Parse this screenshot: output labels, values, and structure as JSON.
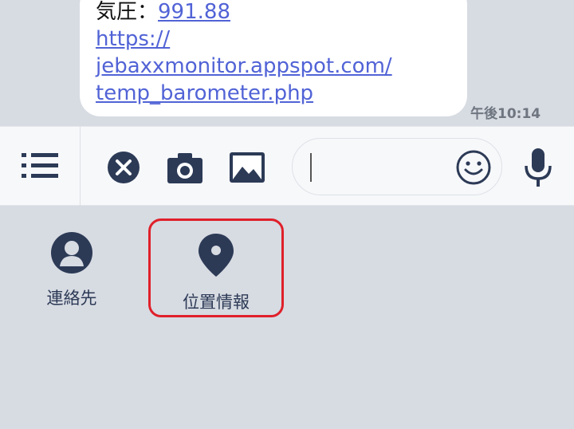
{
  "message": {
    "pressure_label": "気圧：",
    "pressure_value": "991.88",
    "link_line1": "https://",
    "link_line2": "jebaxxmonitor.appspot.com/",
    "link_line3": "temp_barometer.php",
    "timestamp": "午後10:14"
  },
  "input_bar": {
    "text_value": "",
    "icons": [
      "menu-icon",
      "close-icon",
      "camera-icon",
      "image-icon",
      "emoji-icon",
      "mic-icon"
    ]
  },
  "attachments": {
    "items": [
      {
        "label": "連絡先",
        "icon": "contact-icon"
      },
      {
        "label": "位置情報",
        "icon": "location-pin-icon"
      }
    ],
    "highlight_color": "#e0202a"
  },
  "colors": {
    "icon": "#2c3a56",
    "link": "#5163d6",
    "background": "#d7dbe2"
  }
}
